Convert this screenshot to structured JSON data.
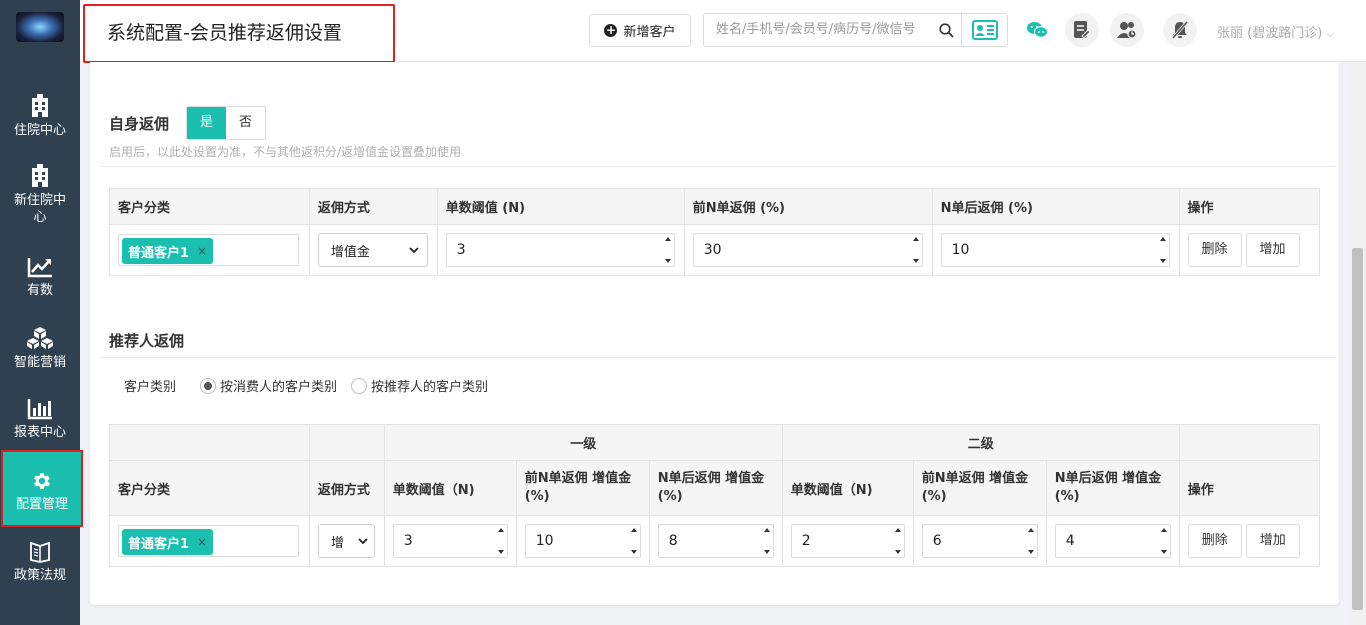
{
  "sidebar": {
    "items": [
      {
        "label": "住院中心",
        "icon": "hospital-icon"
      },
      {
        "label": "新住院中心",
        "icon": "hospital-icon"
      },
      {
        "label": "有数",
        "icon": "trend-chart-icon"
      },
      {
        "label": "智能营销",
        "icon": "cubes-icon"
      },
      {
        "label": "报表中心",
        "icon": "bar-chart-icon"
      },
      {
        "label": "配置管理",
        "icon": "gear-icon",
        "active": true
      },
      {
        "label": "政策法规",
        "icon": "book-icon"
      }
    ]
  },
  "header": {
    "title": "系统配置-会员推荐返佣设置",
    "new_customer_label": "新增客户",
    "search_placeholder": "姓名/手机号/会员号/病历号/微信号",
    "user_name": "张丽 (碧波路门诊)",
    "icons": [
      "id-card-icon",
      "wechat-icon",
      "document-icon",
      "user-group-icon",
      "notification-off-icon"
    ]
  },
  "self_rebate": {
    "title": "自身返佣",
    "toggle_yes": "是",
    "toggle_no": "否",
    "selected": "是",
    "hint": "启用后，以此处设置为准，不与其他返积分/返增值金设置叠加使用",
    "columns": [
      "客户分类",
      "返佣方式",
      "单数阈值 (N)",
      "前N单返佣 (%)",
      "N单后返佣 (%)",
      "操作"
    ],
    "row": {
      "tag": "普通客户1",
      "method": "增值金",
      "threshold": "3",
      "first_n_pct": "30",
      "after_n_pct": "10",
      "delete_label": "删除",
      "add_label": "增加"
    }
  },
  "referrer_rebate": {
    "title": "推荐人返佣",
    "category_label": "客户类别",
    "radio_options": [
      "按消费人的客户类别",
      "按推荐人的客户类别"
    ],
    "radio_selected": 0,
    "level1_label": "一级",
    "level2_label": "二级",
    "columns": {
      "category": "客户分类",
      "method": "返佣方式",
      "threshold": "单数阈值（N)",
      "first_n": "前N单返佣 增值金 (%)",
      "after_n": "N单后返佣 增值金 (%)",
      "ops": "操作"
    },
    "row": {
      "tag": "普通客户1",
      "method": "增",
      "l1_threshold": "3",
      "l1_first": "10",
      "l1_after": "8",
      "l2_threshold": "2",
      "l2_first": "6",
      "l2_after": "4",
      "delete_label": "删除",
      "add_label": "增加"
    }
  },
  "colors": {
    "sidebar_bg": "#2f4050",
    "accent": "#1bbfb0",
    "highlight_border": "#e02020"
  }
}
